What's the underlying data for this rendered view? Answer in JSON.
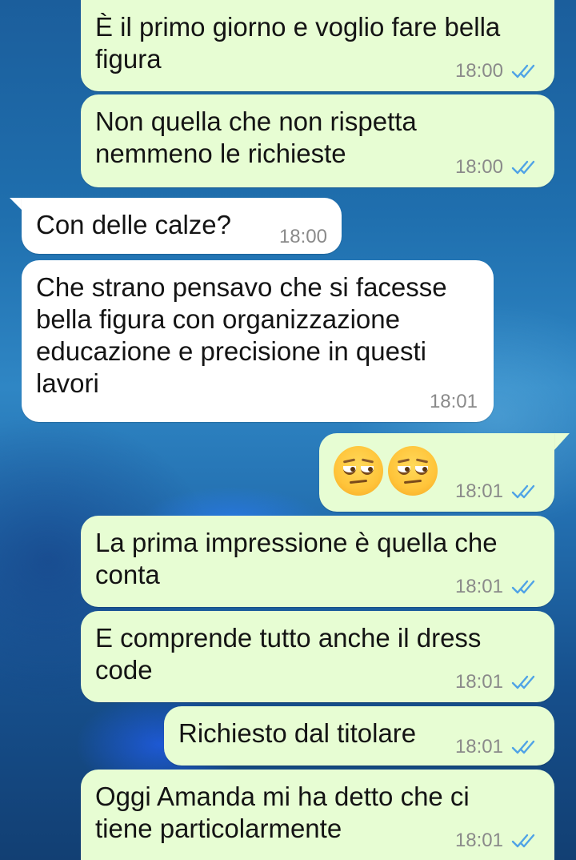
{
  "colors": {
    "outgoing_bubble": "#e7fdd3",
    "incoming_bubble": "#ffffff",
    "read_ticks": "#4fa3e6",
    "time_text": "#8a8a8a"
  },
  "messages": [
    {
      "direction": "outgoing",
      "text": "È il primo giorno e voglio fare bella figura",
      "time": "18:00",
      "status": "read"
    },
    {
      "direction": "outgoing",
      "text": "Non quella che non rispetta nemmeno le richieste",
      "time": "18:00",
      "status": "read"
    },
    {
      "direction": "incoming",
      "text": "Con delle calze?",
      "time": "18:00"
    },
    {
      "direction": "incoming",
      "text": "Che strano pensavo che si facesse bella figura con organizzazione educazione e precisione in questi lavori",
      "time": "18:01"
    },
    {
      "direction": "outgoing",
      "text": "",
      "emoji": [
        "unamused-face-emoji",
        "unamused-face-emoji"
      ],
      "time": "18:01",
      "status": "read"
    },
    {
      "direction": "outgoing",
      "text": "La prima impressione è quella che conta",
      "time": "18:01",
      "status": "read"
    },
    {
      "direction": "outgoing",
      "text": "E comprende tutto anche il dress code",
      "time": "18:01",
      "status": "read"
    },
    {
      "direction": "outgoing",
      "text": "Richiesto dal titolare",
      "time": "18:01",
      "status": "read"
    },
    {
      "direction": "outgoing",
      "text": "Oggi Amanda mi ha detto che ci tiene particolarmente",
      "time": "18:01",
      "status": "read"
    }
  ]
}
